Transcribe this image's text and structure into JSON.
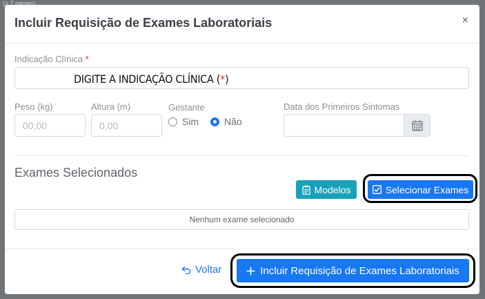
{
  "backdrop": {
    "fragment": "(≥ 7 meses)"
  },
  "modal": {
    "title": "Incluir Requisição de Exames Laboratoriais",
    "close_label": "×"
  },
  "form": {
    "indicacao": {
      "label": "Indicação Clínica",
      "required_mark": "*",
      "overlay_text": "DIGITE A INDICAÇÃO CLÍNICA (",
      "overlay_star": "*",
      "overlay_close": ")"
    },
    "peso": {
      "label": "Peso (kg)",
      "placeholder": "00,00"
    },
    "altura": {
      "label": "Altura (m)",
      "placeholder": "0,00"
    },
    "gestante": {
      "label": "Gestante",
      "options": [
        "Sim",
        "Não"
      ],
      "selected": "Não"
    },
    "data_sintomas": {
      "label": "Data dos Primeiros Sintomas",
      "value": ""
    }
  },
  "exames": {
    "section_title": "Exames Selecionados",
    "modelos_label": "Modelos",
    "selecionar_label": "Selecionar Exames",
    "empty_text": "Nenhum exame selecionado"
  },
  "footer": {
    "voltar_label": "Voltar",
    "incluir_label": "Incluir Requisição de Exames Laboratoriais"
  },
  "colors": {
    "primary": "#1877f2",
    "info": "#17a2b8",
    "required": "#e03131"
  }
}
